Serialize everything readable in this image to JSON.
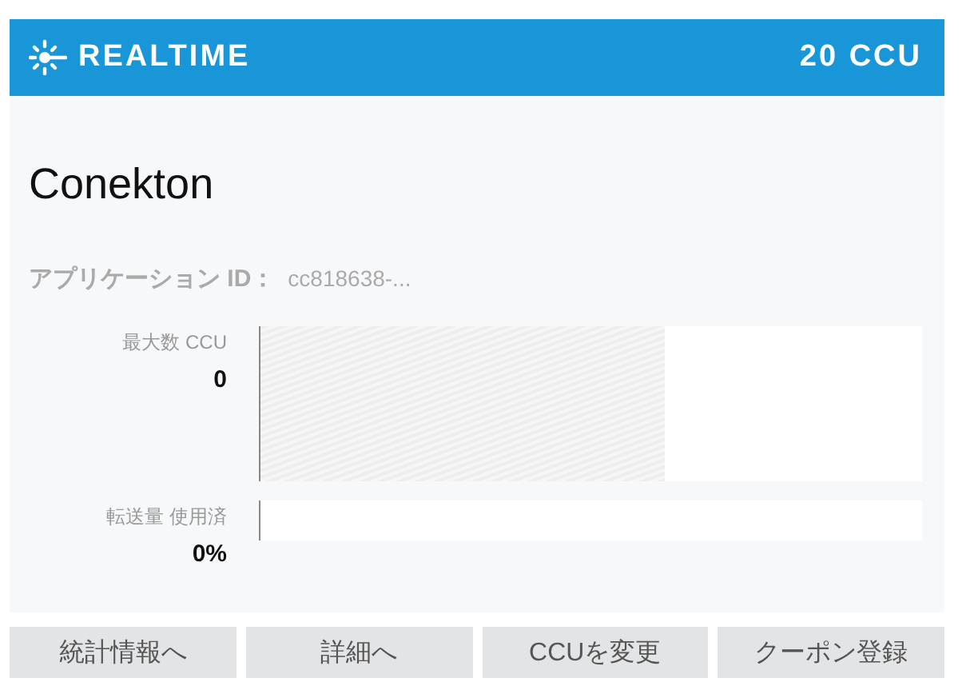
{
  "header": {
    "title": "REALTIME",
    "plan": "20 CCU"
  },
  "app": {
    "name": "Conekton",
    "id_label": "アプリケーション ID：",
    "id_value": "cc818638-..."
  },
  "meters": [
    {
      "label": "最大数 CCU",
      "value": "0",
      "level": 0.61,
      "kind": "tall"
    },
    {
      "label": "転送量 使用済",
      "value": "0%",
      "level": 0,
      "kind": "short"
    }
  ],
  "buttons": [
    "統計情報へ",
    "詳細へ",
    "CCUを変更",
    "クーポン登録"
  ]
}
